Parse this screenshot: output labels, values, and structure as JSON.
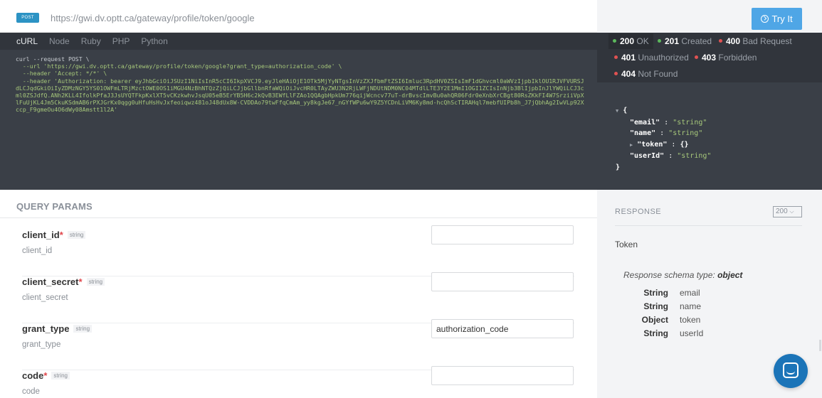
{
  "request": {
    "method": "POST",
    "url": "https://gwi.dv.optt.ca/gateway/profile/token/google",
    "try_label": "Try It"
  },
  "lang_tabs": [
    "cURL",
    "Node",
    "Ruby",
    "PHP",
    "Python"
  ],
  "code": {
    "line1": "curl --request POST \\",
    "line2": "  --url 'https://gwi.dv.optt.ca/gateway/profile/token/google?grant_type=authorization_code' \\",
    "line3": "  --header 'Accept: */*' \\",
    "line4": "  --header 'Authorization: bearer eyJhbGciOiJSUzI1NiIsInR5cCI6IkpXVCJ9.eyJleHAiOjE1OTk5MjYyNTgsInVzZXJfbmFtZSI6Imluc3RpdHV0ZSIsImF1dGhvcml0aWVzIjpbIklOU1RJVFVURSJdLCJqdGkiOiIyZDMzNGY5YS01OWFmLTRjMzctOWE0OS1iMGU4NzBhNTQzZjQiLCJjbGllbnRfaWQiOiJvcHR0LTAyZWU3N2RjLWFjNDUtNDM0NC04MTdlLTE3Y2E1MmI1OGI1ZCIsInNjb3BlIjpbInJlYWQiLCJ3cml0ZSJdfQ.ANh2KLL4IfolkPfaJ3JsUYQTFkpKxlXT5vCKzkwhvJsqU05eB5ErYB5H6c2kQvB3EWfLlFZAo1QQAgbHpkUm776qijWcncv77uT-drBvscImvBu0ahQR06Fdr0eXnbXrCBgt80RsZKkFI4W7SrziiVpXlFuUjKL4Jm5CkuKSdmAB6rPXJGrKx0qgg0uHfuHsHvJxfeoiqwz481oJ48dUx8W-CVDDAo79twFfqCmAm_yy8kgJe67_nGYfWPu6wY9Z5YCDnLiVM6Ky8md-hcQhScTIRAHql7mebfUIPb8h_J7jQbhAg2IwVLp92Xccp_F9gmeOu4O6dWy08Amstt1l2A'"
  },
  "statuses": [
    {
      "code": "200",
      "text": "OK",
      "color": "#5cb85c"
    },
    {
      "code": "201",
      "text": "Created",
      "color": "#5cb85c"
    },
    {
      "code": "400",
      "text": "Bad Request",
      "color": "#e05252"
    },
    {
      "code": "401",
      "text": "Unauthorized",
      "color": "#e05252"
    },
    {
      "code": "403",
      "text": "Forbidden",
      "color": "#e05252"
    },
    {
      "code": "404",
      "text": "Not Found",
      "color": "#e05252"
    }
  ],
  "json_example": {
    "open": "{",
    "email_key": "\"email\"",
    "email_val": "\"string\"",
    "name_key": "\"name\"",
    "name_val": "\"string\"",
    "token_key": "\"token\"",
    "token_val": "{}",
    "userId_key": "\"userId\"",
    "userId_val": "\"string\"",
    "close": "}"
  },
  "query_params": {
    "heading": "QUERY PARAMS",
    "items": [
      {
        "name": "client_id",
        "required": true,
        "type": "string",
        "desc": "client_id",
        "value": ""
      },
      {
        "name": "client_secret",
        "required": true,
        "type": "string",
        "desc": "client_secret",
        "value": ""
      },
      {
        "name": "grant_type",
        "required": false,
        "type": "string",
        "desc": "grant_type",
        "value": "authorization_code"
      },
      {
        "name": "code",
        "required": true,
        "type": "string",
        "desc": "code",
        "value": ""
      }
    ]
  },
  "response": {
    "label": "RESPONSE",
    "selected": "200",
    "description": "Token",
    "schema_type_label": "Response schema type:",
    "schema_type": "object",
    "fields": [
      {
        "type": "String",
        "name": "email"
      },
      {
        "type": "String",
        "name": "name"
      },
      {
        "type": "Object",
        "name": "token"
      },
      {
        "type": "String",
        "name": "userId"
      }
    ]
  }
}
